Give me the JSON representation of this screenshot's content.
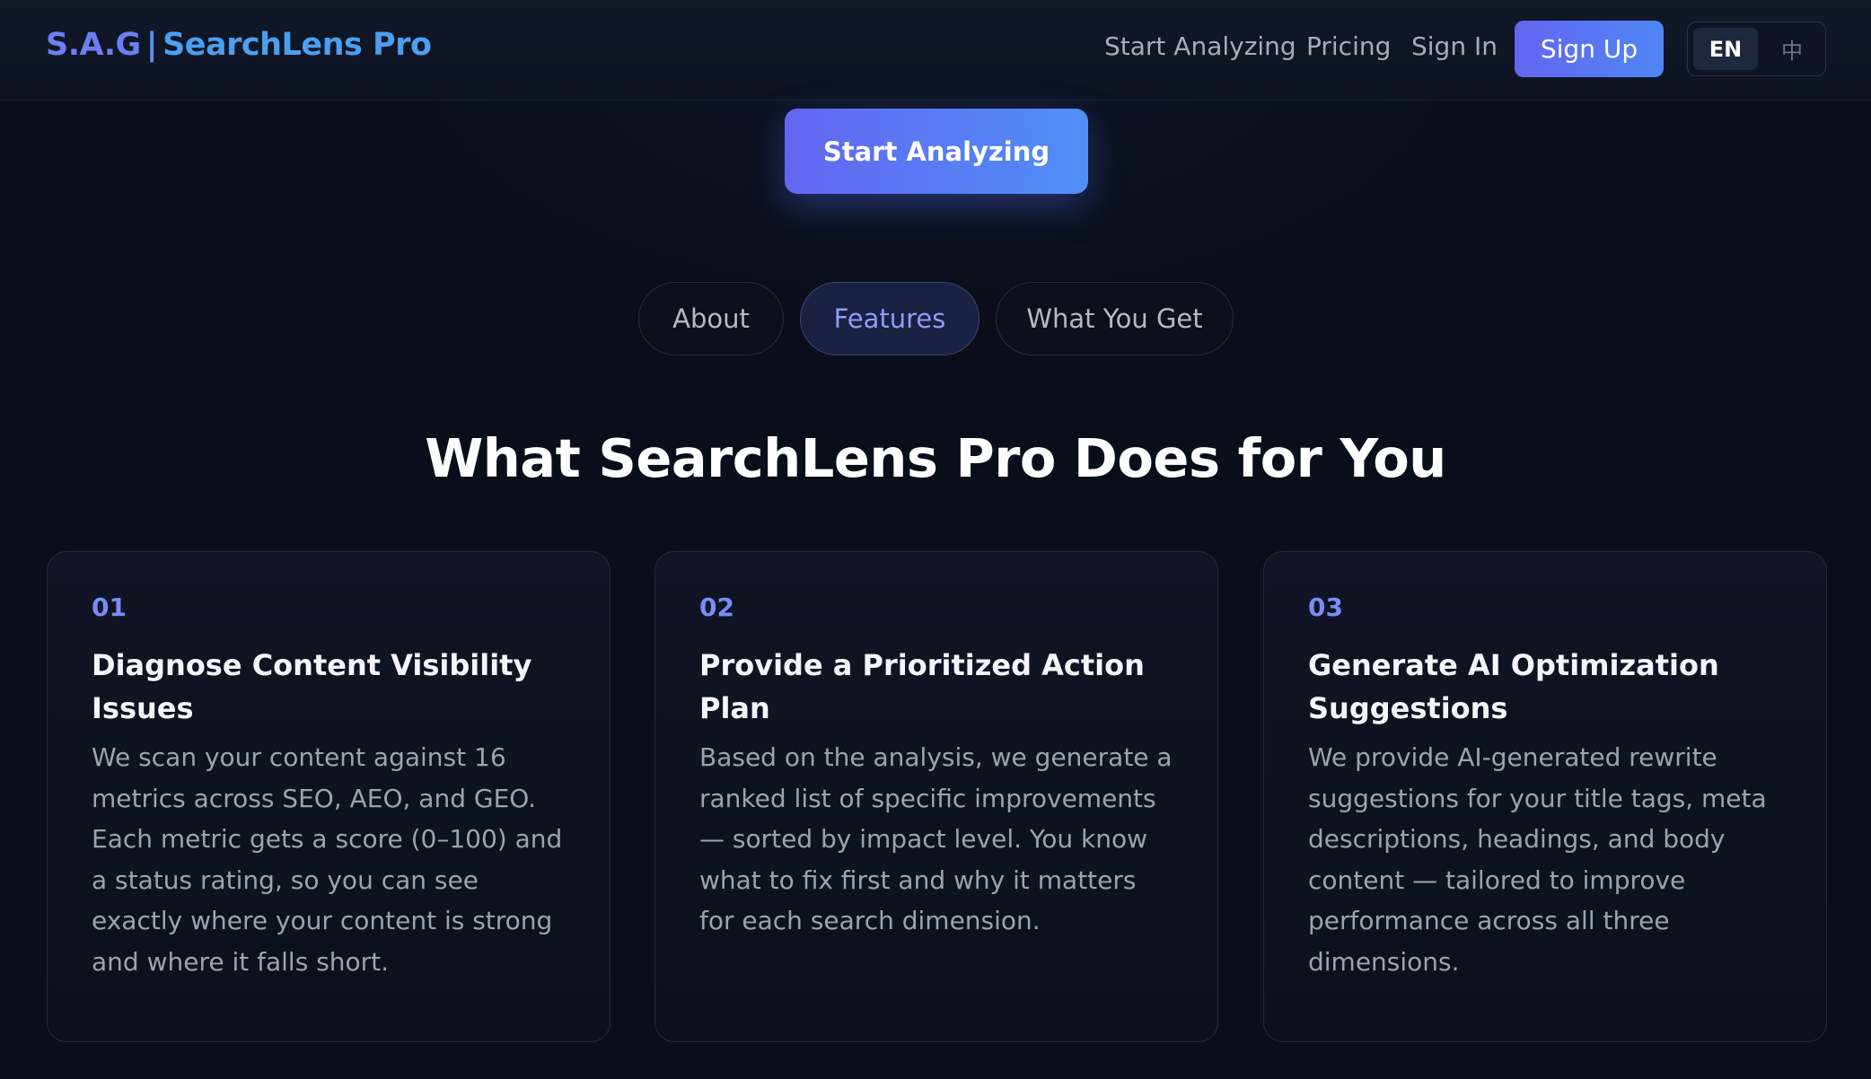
{
  "header": {
    "brand_prefix": "S.A.G",
    "brand_separator": "|",
    "brand_name": "SearchLens Pro",
    "nav": {
      "start_analyzing": "Start Analyzing",
      "pricing": "Pricing",
      "sign_in": "Sign In"
    },
    "sign_up_label": "Sign Up",
    "language": {
      "en": "EN",
      "zh": "中",
      "selected": "EN"
    }
  },
  "hero": {
    "cta_label": "Start Analyzing"
  },
  "tabs": [
    {
      "label": "About",
      "active": false
    },
    {
      "label": "Features",
      "active": true
    },
    {
      "label": "What You Get",
      "active": false
    }
  ],
  "section": {
    "title": "What SearchLens Pro Does for You",
    "cards": [
      {
        "number": "01",
        "title": "Diagnose Content Visibility Issues",
        "text": "We scan your content against 16 metrics across SEO, AEO, and GEO. Each metric gets a score (0–100) and a status rating, so you can see exactly where your content is strong and where it falls short."
      },
      {
        "number": "02",
        "title": "Provide a Prioritized Action Plan",
        "text": "Based on the analysis, we generate a ranked list of specific improvements — sorted by impact level. You know what to fix first and why it matters for each search dimension."
      },
      {
        "number": "03",
        "title": "Generate AI Optimization Suggestions",
        "text": "We provide AI-generated rewrite suggestions for your title tags, meta descriptions, headings, and body content — tailored to improve performance across all three dimensions."
      }
    ]
  },
  "colors": {
    "background": "#090e1a",
    "accent_start": "#6366f1",
    "accent_end": "#4f8ff6",
    "card_number": "#7c8cf5",
    "active_tab_text": "#8e9cf7"
  }
}
